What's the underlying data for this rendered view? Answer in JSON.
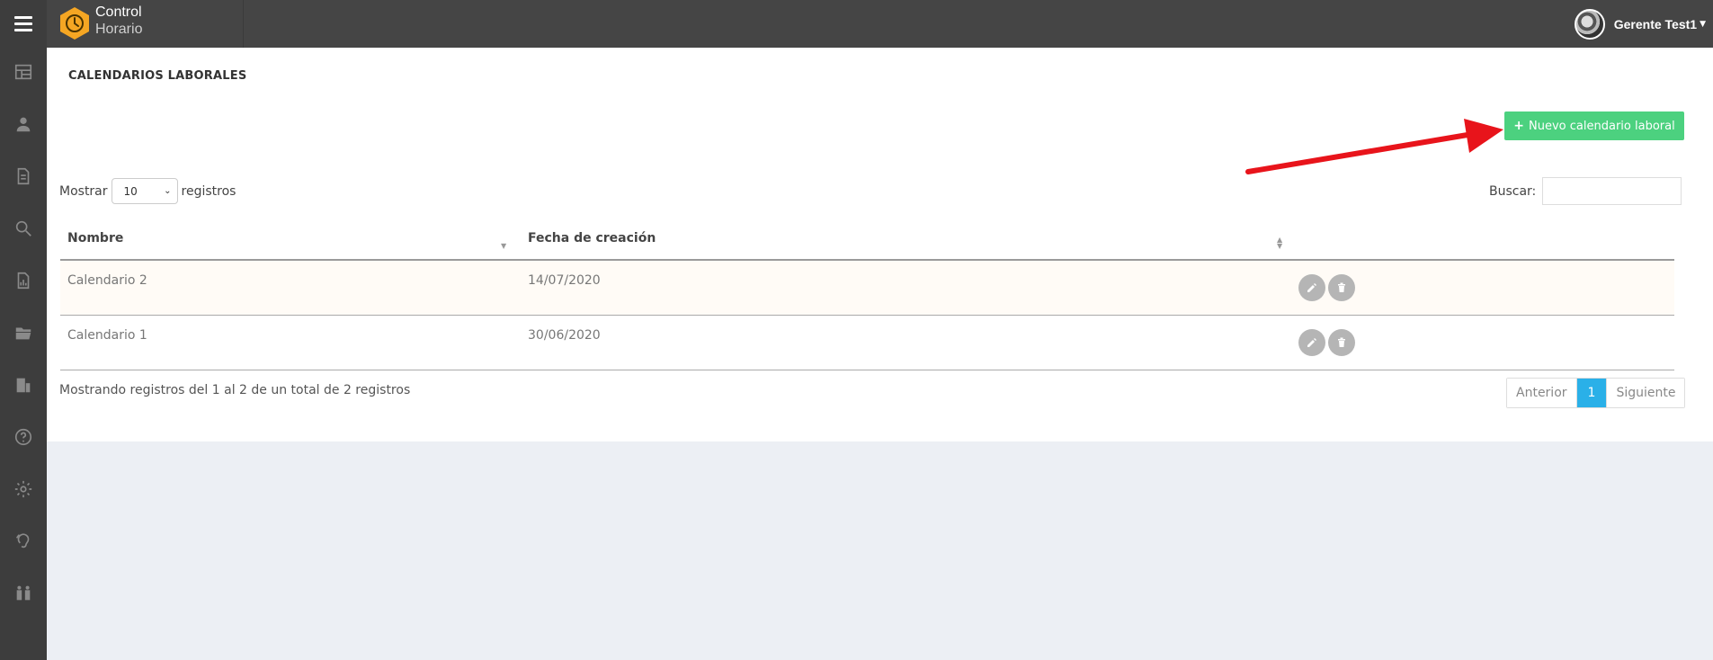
{
  "brand": {
    "line1": "Control",
    "line2": "Horario",
    "logo_color": "#f5a623"
  },
  "user": {
    "name": "Gerente Test1"
  },
  "sidebar": {
    "items": [
      {
        "icon": "dashboard-icon"
      },
      {
        "icon": "user-icon"
      },
      {
        "icon": "document-icon"
      },
      {
        "icon": "search-icon"
      },
      {
        "icon": "report-icon"
      },
      {
        "icon": "folder-icon"
      },
      {
        "icon": "building-icon"
      },
      {
        "icon": "help-icon"
      },
      {
        "icon": "gear-icon"
      },
      {
        "icon": "accessibility-icon"
      },
      {
        "icon": "team-icon"
      }
    ]
  },
  "page": {
    "title": "CALENDARIOS LABORALES"
  },
  "toolbar": {
    "new_label": "Nuevo calendario laboral",
    "new_color": "#4cd17f"
  },
  "table_controls": {
    "show_label": "Mostrar",
    "show_value": "10",
    "records_label": "registros",
    "search_label": "Buscar:",
    "search_value": ""
  },
  "table": {
    "columns": [
      "Nombre",
      "Fecha de creación"
    ],
    "rows": [
      {
        "name": "Calendario 2",
        "date": "14/07/2020"
      },
      {
        "name": "Calendario 1",
        "date": "30/06/2020"
      }
    ]
  },
  "footer": {
    "info": "Mostrando registros del 1 al 2 de un total de 2 registros",
    "prev": "Anterior",
    "page": "1",
    "next": "Siguiente",
    "active_color": "#2ab0e8"
  },
  "annotation": {
    "arrow_color": "#e8141b"
  }
}
